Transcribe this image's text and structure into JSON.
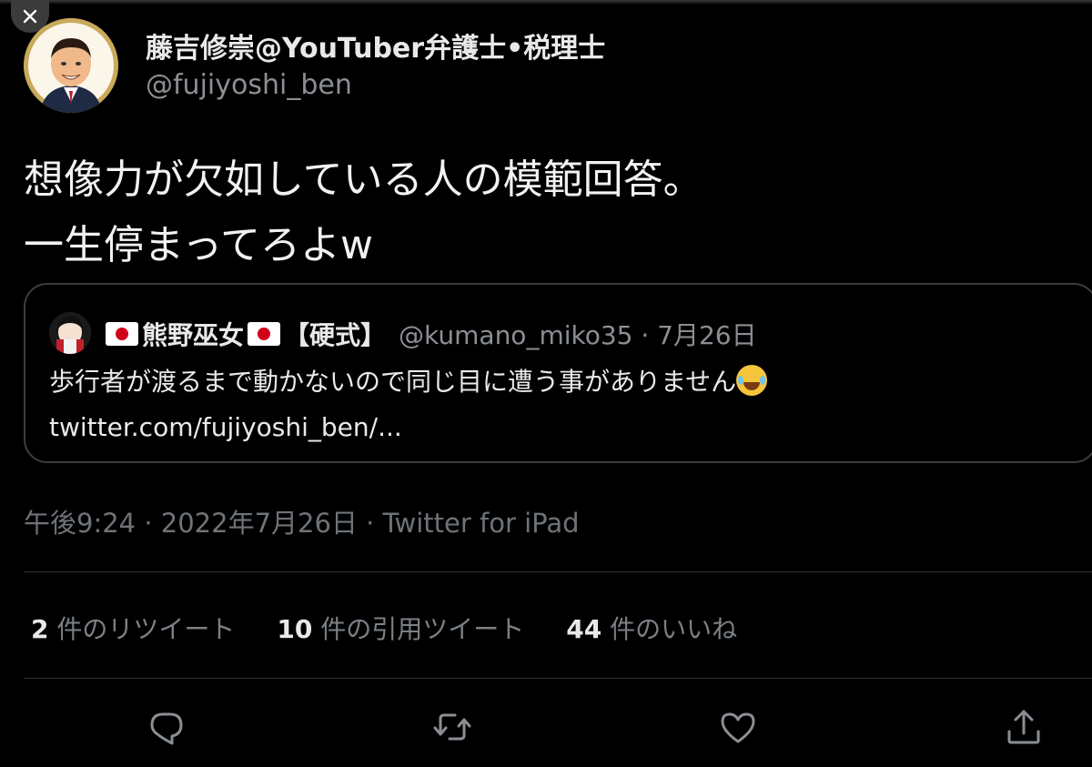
{
  "author": {
    "display_name": "藤吉修崇@YouTuber弁護士•税理士",
    "handle": "@fujiyoshi_ben"
  },
  "tweet": {
    "lines": [
      "想像力が欠如している人の模範回答。",
      "一生停まってろよw"
    ]
  },
  "quote": {
    "name": "熊野巫女",
    "suffix": "【硬式】",
    "handle_date": "@kumano_miko35 · 7月26日",
    "text": "歩行者が渡るまで動かないので同じ目に遭う事がありません",
    "link": "twitter.com/fujiyoshi_ben/..."
  },
  "timestamp": "午後9:24 · 2022年7月26日 · Twitter for iPad",
  "stats": [
    {
      "count": "2",
      "label": "件のリツイート"
    },
    {
      "count": "10",
      "label": "件の引用ツイート"
    },
    {
      "count": "44",
      "label": "件のいいね"
    }
  ],
  "colors": {
    "background": "#000000",
    "primary_text": "#e7e9ea",
    "secondary_text": "#8b8f94",
    "divider": "#2f3336",
    "flag_red": "#d0021b"
  },
  "icons": {
    "close": "close-icon",
    "reply": "reply-icon",
    "retweet": "retweet-icon",
    "like": "heart-icon",
    "share": "share-icon"
  }
}
